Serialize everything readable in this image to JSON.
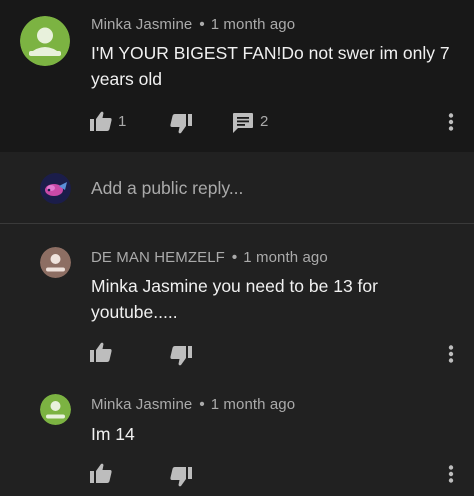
{
  "main_comment": {
    "author": "Minka Jasmine",
    "time": "1 month ago",
    "separator": "•",
    "text_line1": "I'M YOUR BIGEST FAN!Do not swer im only 7",
    "text_line2": "years old",
    "like_count": "1",
    "reply_count": "2",
    "avatar_color": "#7cb342"
  },
  "reply_box": {
    "placeholder": "Add a public reply..."
  },
  "replies": [
    {
      "author": "DE MAN HEMZELF",
      "time": "1 month ago",
      "separator": "•",
      "text_line1": "Minka Jasmine you need to be 13 for",
      "text_line2": "youtube.....",
      "avatar_color": "#8d6e63"
    },
    {
      "author": "Minka Jasmine",
      "time": "1 month ago",
      "separator": "•",
      "text_line1": "Im 14",
      "avatar_color": "#7cb342"
    }
  ],
  "icons": {
    "like": "thumbs-up-icon",
    "dislike": "thumbs-down-icon",
    "reply": "comment-icon",
    "more": "more-vert-icon"
  }
}
